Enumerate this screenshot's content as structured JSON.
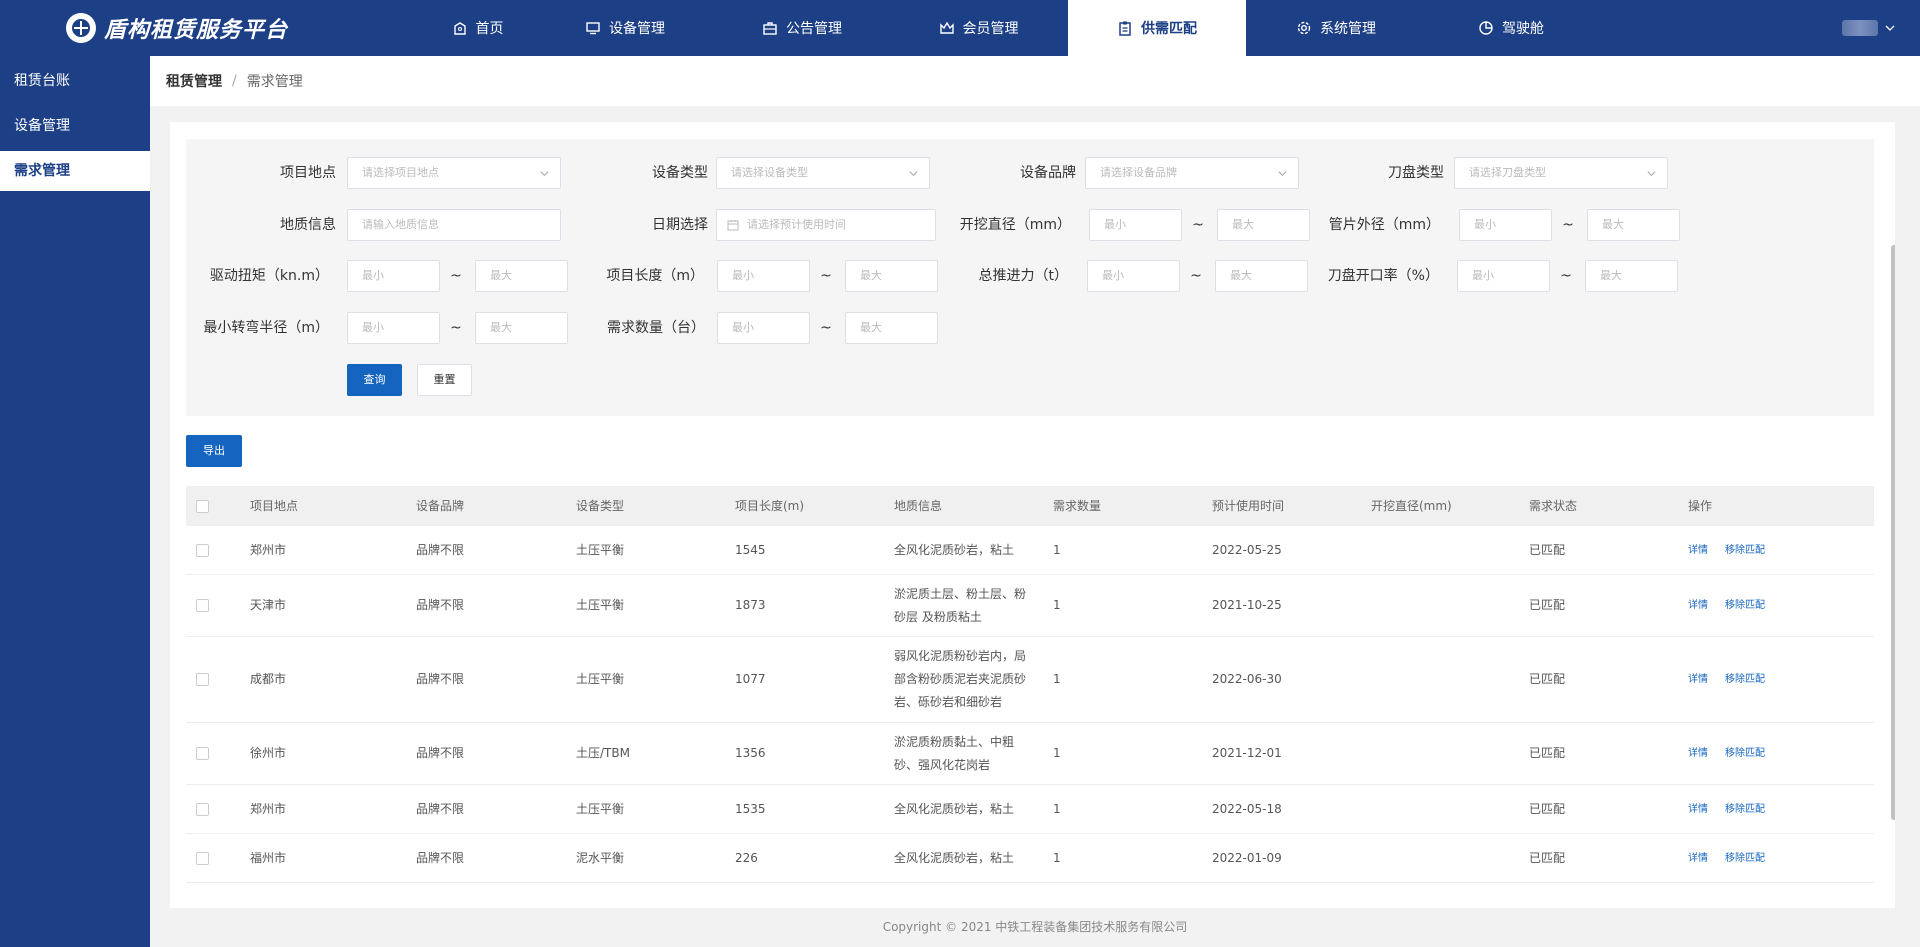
{
  "app": {
    "title": "盾构租赁服务平台"
  },
  "nav": [
    {
      "label": "首页",
      "icon": "home-icon"
    },
    {
      "label": "设备管理",
      "icon": "monitor-icon"
    },
    {
      "label": "公告管理",
      "icon": "briefcase-icon"
    },
    {
      "label": "会员管理",
      "icon": "crown-icon"
    },
    {
      "label": "供需匹配",
      "icon": "clipboard-icon",
      "active": true
    },
    {
      "label": "系统管理",
      "icon": "gear-icon"
    },
    {
      "label": "驾驶舱",
      "icon": "pie-chart-icon"
    }
  ],
  "sidebar": [
    {
      "label": "租赁台账"
    },
    {
      "label": "设备管理"
    },
    {
      "label": "需求管理",
      "active": true
    }
  ],
  "breadcrumb": {
    "first": "租赁管理",
    "sep": "/",
    "last": "需求管理"
  },
  "filters": {
    "location": {
      "label": "项目地点",
      "placeholder": "请选择项目地点"
    },
    "equip_type": {
      "label": "设备类型",
      "placeholder": "请选择设备类型"
    },
    "equip_brand": {
      "label": "设备品牌",
      "placeholder": "请选择设备品牌"
    },
    "cutter_type": {
      "label": "刀盘类型",
      "placeholder": "请选择刀盘类型"
    },
    "geology": {
      "label": "地质信息",
      "placeholder": "请输入地质信息"
    },
    "date": {
      "label": "日期选择",
      "placeholder": "请选择预计使用时间"
    },
    "bore_dia": {
      "label": "开挖直径（mm）"
    },
    "segment_od": {
      "label": "管片外径（mm）"
    },
    "torque": {
      "label": "驱动扭矩（kn.m）"
    },
    "length": {
      "label": "项目长度（m）"
    },
    "thrust": {
      "label": "总推进力（t）"
    },
    "opening_rate": {
      "label": "刀盘开口率（%）"
    },
    "turn_radius": {
      "label": "最小转弯半径（m）"
    },
    "quantity": {
      "label": "需求数量（台）"
    },
    "min_ph": "最小",
    "max_ph": "最大",
    "tilde": "~",
    "query_btn": "查询",
    "reset_btn": "重置"
  },
  "export_btn": "导出",
  "table": {
    "headers": [
      "项目地点",
      "设备品牌",
      "设备类型",
      "项目长度(m)",
      "地质信息",
      "需求数量",
      "预计使用时间",
      "开挖直径(mm)",
      "需求状态",
      "操作"
    ],
    "ops": [
      "详情",
      "移除匹配"
    ],
    "rows": [
      {
        "loc": "郑州市",
        "brand": "品牌不限",
        "type": "土压平衡",
        "len": "1545",
        "geo": [
          "全风化泥质砂岩，粘土"
        ],
        "qty": "1",
        "date": "2022-05-25",
        "dia": "",
        "status": "已匹配"
      },
      {
        "loc": "天津市",
        "brand": "品牌不限",
        "type": "土压平衡",
        "len": "1873",
        "geo": [
          "淤泥质土层、粉土层、粉",
          "砂层 及粉质粘土"
        ],
        "qty": "1",
        "date": "2021-10-25",
        "dia": "",
        "status": "已匹配"
      },
      {
        "loc": "成都市",
        "brand": "品牌不限",
        "type": "土压平衡",
        "len": "1077",
        "geo": [
          "弱风化泥质粉砂岩内，局",
          "部含粉砂质泥岩夹泥质砂",
          "岩、砾砂岩和细砂岩"
        ],
        "qty": "1",
        "date": "2022-06-30",
        "dia": "",
        "status": "已匹配"
      },
      {
        "loc": "徐州市",
        "brand": "品牌不限",
        "type": "土压/TBM",
        "len": "1356",
        "geo": [
          "淤泥质粉质黏土、中粗",
          "砂、强风化花岗岩"
        ],
        "qty": "1",
        "date": "2021-12-01",
        "dia": "",
        "status": "已匹配"
      },
      {
        "loc": "郑州市",
        "brand": "品牌不限",
        "type": "土压平衡",
        "len": "1535",
        "geo": [
          "全风化泥质砂岩，粘土"
        ],
        "qty": "1",
        "date": "2022-05-18",
        "dia": "",
        "status": "已匹配"
      },
      {
        "loc": "福州市",
        "brand": "品牌不限",
        "type": "泥水平衡",
        "len": "226",
        "geo": [
          "全风化泥质砂岩，粘土"
        ],
        "qty": "1",
        "date": "2022-01-09",
        "dia": "",
        "status": "已匹配"
      }
    ]
  },
  "footer": "Copyright © 2021 中铁工程装备集团技术服务有限公司"
}
